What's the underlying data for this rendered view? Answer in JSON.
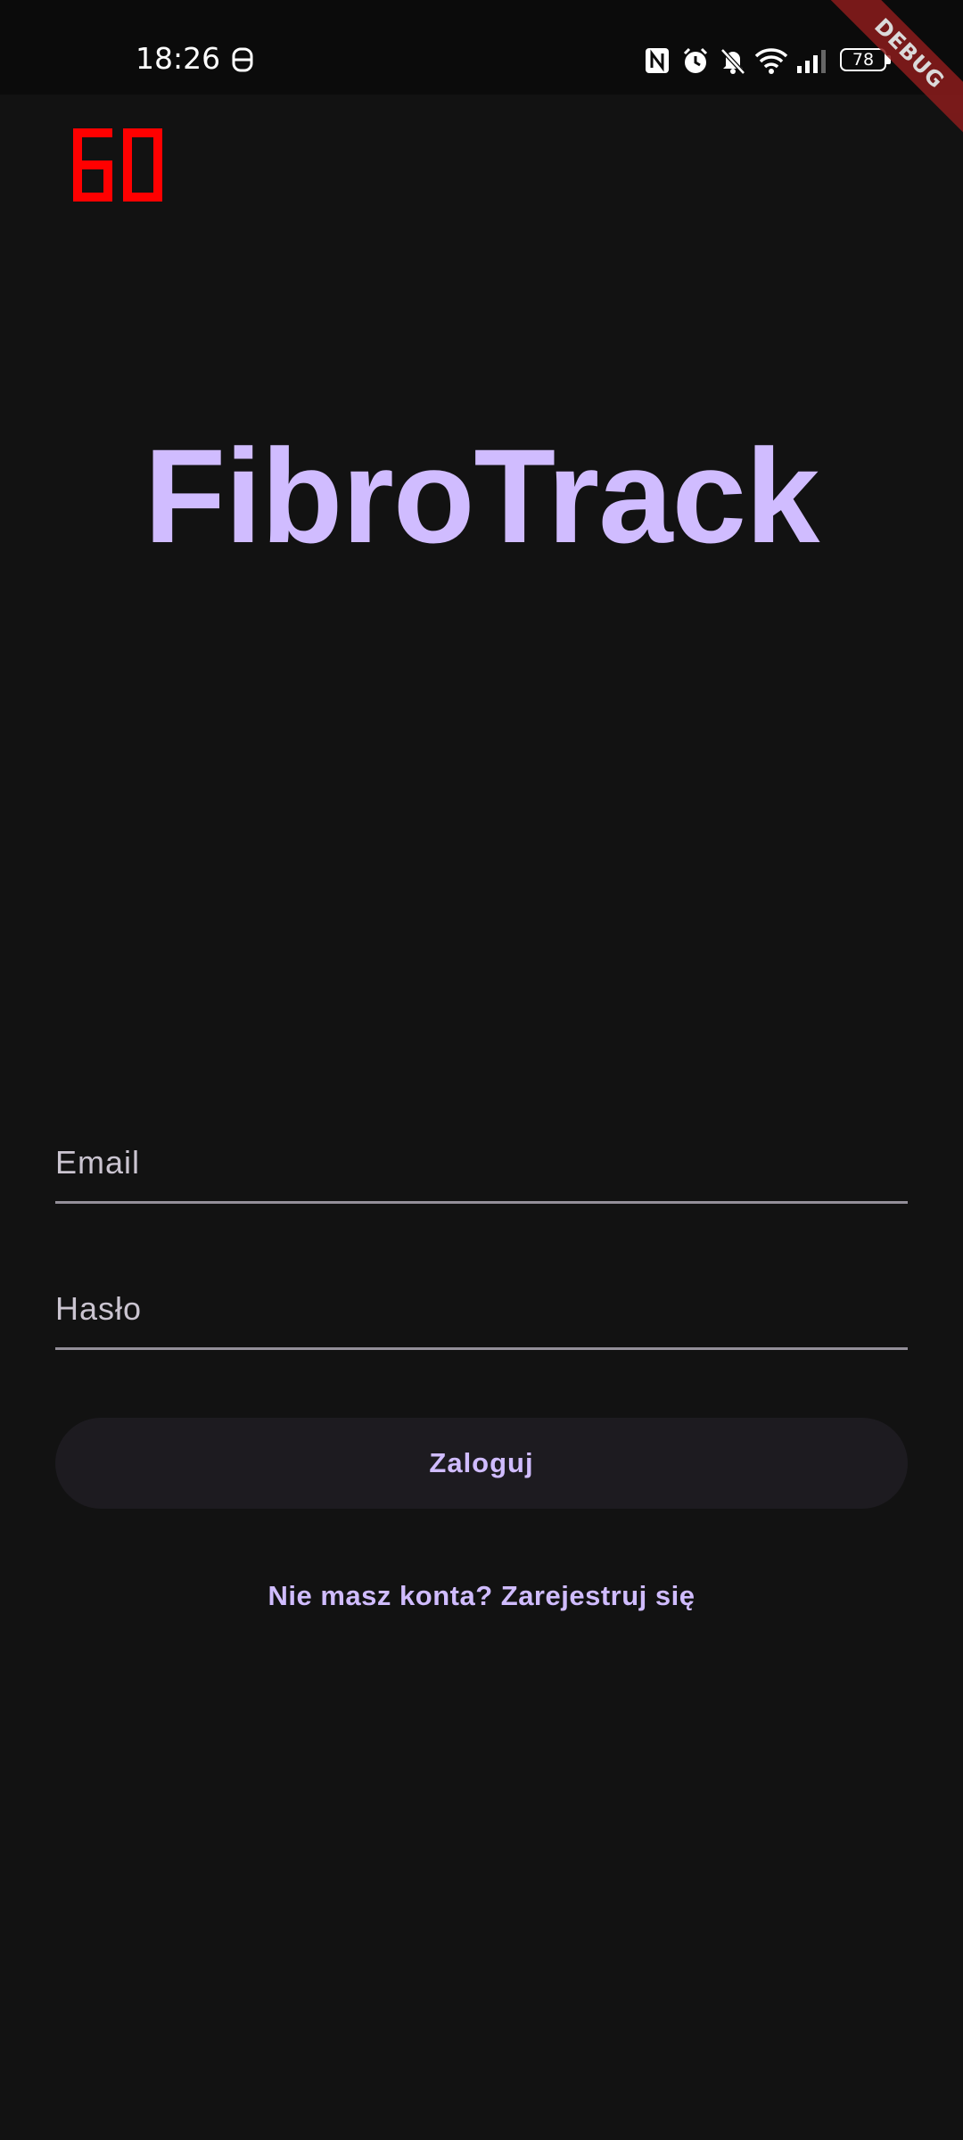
{
  "status_bar": {
    "time": "18:26",
    "battery_level": "78",
    "icons": [
      "vpn-key-icon",
      "nfc-icon",
      "alarm-icon",
      "mute-icon",
      "wifi-icon",
      "signal-icon",
      "battery-icon"
    ]
  },
  "debug": {
    "fps": "60",
    "banner_label": "DEBUG"
  },
  "app": {
    "title": "FibroTrack"
  },
  "login_form": {
    "email_placeholder": "Email",
    "email_value": "",
    "password_placeholder": "Hasło",
    "password_value": "",
    "submit_label": "Zaloguj",
    "register_link": "Nie masz konta? Zarejestruj się"
  },
  "colors": {
    "background": "#121212",
    "accent": "#d0bcff",
    "field_underline": "#938f99",
    "button_bg": "#1d1b20",
    "fps_color": "#ff0000",
    "debug_banner": "#8b1c1c"
  }
}
